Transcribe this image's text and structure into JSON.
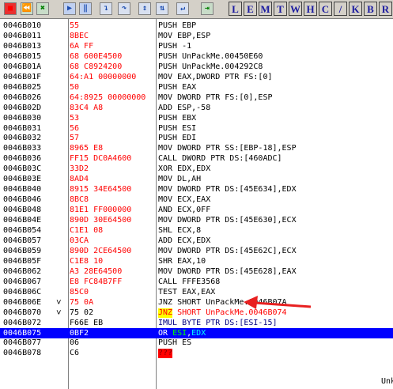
{
  "toolbar": {
    "icon_buttons": [
      {
        "glyph": "■",
        "name": "stop-icon",
        "style": "red"
      },
      {
        "glyph": "⏪",
        "name": "restart-icon",
        "style": "green"
      },
      {
        "glyph": "✖",
        "name": "close-icon",
        "style": "green"
      },
      {
        "glyph": "▶",
        "name": "run-icon",
        "style": "pale"
      },
      {
        "glyph": "‖",
        "name": "pause-icon",
        "style": "pale"
      },
      {
        "glyph": "↴",
        "name": "step-into-icon",
        "style": "pale2"
      },
      {
        "glyph": "↷",
        "name": "step-over-icon",
        "style": "pale2"
      },
      {
        "glyph": "↕",
        "name": "trace-into-icon",
        "style": "pale2"
      },
      {
        "glyph": "⇅",
        "name": "trace-over-icon",
        "style": "pale2"
      },
      {
        "glyph": "↵",
        "name": "execute-till-return-icon",
        "style": "pale2"
      },
      {
        "glyph": "⇥",
        "name": "go-to-icon",
        "style": "green"
      }
    ],
    "letter_buttons": [
      "L",
      "E",
      "M",
      "T",
      "W",
      "H",
      "C",
      "/",
      "K",
      "B",
      "R"
    ]
  },
  "rows": [
    {
      "addr": "0046B010",
      "mark": "",
      "hex": "55",
      "hex_red": true,
      "asm": "PUSH EBP"
    },
    {
      "addr": "0046B011",
      "mark": "",
      "hex": "8BEC",
      "hex_red": true,
      "asm": "MOV EBP,ESP"
    },
    {
      "addr": "0046B013",
      "mark": "",
      "hex": "6A FF",
      "hex_red": true,
      "asm": "PUSH -1"
    },
    {
      "addr": "0046B015",
      "mark": "",
      "hex": "68 600E4500",
      "hex_red": true,
      "asm": "PUSH UnPackMe.00450E60"
    },
    {
      "addr": "0046B01A",
      "mark": "",
      "hex": "68 C8924200",
      "hex_red": true,
      "asm": "PUSH UnPackMe.004292C8"
    },
    {
      "addr": "0046B01F",
      "mark": "",
      "hex": "64:A1 00000000",
      "hex_red": true,
      "asm": "MOV EAX,DWORD PTR FS:[0]"
    },
    {
      "addr": "0046B025",
      "mark": "",
      "hex": "50",
      "hex_red": true,
      "asm": "PUSH EAX"
    },
    {
      "addr": "0046B026",
      "mark": "",
      "hex": "64:8925 00000000",
      "hex_red": true,
      "asm": "MOV DWORD PTR FS:[0],ESP"
    },
    {
      "addr": "0046B02D",
      "mark": "",
      "hex": "83C4 A8",
      "hex_red": true,
      "asm": "ADD ESP,-58"
    },
    {
      "addr": "0046B030",
      "mark": "",
      "hex": "53",
      "hex_red": true,
      "asm": "PUSH EBX"
    },
    {
      "addr": "0046B031",
      "mark": "",
      "hex": "56",
      "hex_red": true,
      "asm": "PUSH ESI"
    },
    {
      "addr": "0046B032",
      "mark": "",
      "hex": "57",
      "hex_red": true,
      "asm": "PUSH EDI"
    },
    {
      "addr": "0046B033",
      "mark": "",
      "hex": "8965 E8",
      "hex_red": true,
      "asm": "MOV DWORD PTR SS:[EBP-18],ESP"
    },
    {
      "addr": "0046B036",
      "mark": "",
      "hex": "FF15 DC0A4600",
      "hex_red": true,
      "asm": "CALL DWORD PTR DS:[460ADC]"
    },
    {
      "addr": "0046B03C",
      "mark": "",
      "hex": "33D2",
      "hex_red": true,
      "asm": "XOR EDX,EDX"
    },
    {
      "addr": "0046B03E",
      "mark": "",
      "hex": "8AD4",
      "hex_red": true,
      "asm": "MOV DL,AH"
    },
    {
      "addr": "0046B040",
      "mark": "",
      "hex": "8915 34E64500",
      "hex_red": true,
      "asm": "MOV DWORD PTR DS:[45E634],EDX"
    },
    {
      "addr": "0046B046",
      "mark": "",
      "hex": "8BC8",
      "hex_red": true,
      "asm": "MOV ECX,EAX"
    },
    {
      "addr": "0046B048",
      "mark": "",
      "hex": "81E1 FF000000",
      "hex_red": true,
      "asm": "AND ECX,0FF"
    },
    {
      "addr": "0046B04E",
      "mark": "",
      "hex": "890D 30E64500",
      "hex_red": true,
      "asm": "MOV DWORD PTR DS:[45E630],ECX"
    },
    {
      "addr": "0046B054",
      "mark": "",
      "hex": "C1E1 08",
      "hex_red": true,
      "asm": "SHL ECX,8"
    },
    {
      "addr": "0046B057",
      "mark": "",
      "hex": "03CA",
      "hex_red": true,
      "asm": "ADD ECX,EDX"
    },
    {
      "addr": "0046B059",
      "mark": "",
      "hex": "890D 2CE64500",
      "hex_red": true,
      "asm": "MOV DWORD PTR DS:[45E62C],ECX"
    },
    {
      "addr": "0046B05F",
      "mark": "",
      "hex": "C1E8 10",
      "hex_red": true,
      "asm": "SHR EAX,10"
    },
    {
      "addr": "0046B062",
      "mark": "",
      "hex": "A3 28E64500",
      "hex_red": true,
      "asm": "MOV DWORD PTR DS:[45E628],EAX"
    },
    {
      "addr": "0046B067",
      "mark": "",
      "hex": "E8 FC84B7FF",
      "hex_red": true,
      "asm": "CALL FFFE3568"
    },
    {
      "addr": "0046B06C",
      "mark": "",
      "hex": "85C0",
      "hex_red": true,
      "asm": "TEST EAX,EAX"
    },
    {
      "addr": "0046B06E",
      "mark": "˅",
      "hex": "75 0A",
      "hex_red": true,
      "asm": "JNZ SHORT UnPackMe.0046B07A"
    },
    {
      "addr": "0046B070",
      "mark": "˅",
      "hex": "75 02",
      "hex_red": false,
      "asm": "JNZ SHORT UnPackMe.0046B074",
      "asm_style": "jnz-yellow"
    },
    {
      "addr": "0046B072",
      "mark": "",
      "hex": "F66E EB",
      "hex_red": false,
      "asm": "IMUL BYTE PTR DS:[ESI-15]",
      "asm_style": "blue"
    },
    {
      "addr": "0046B075",
      "mark": "",
      "hex": "0BF2",
      "hex_red": false,
      "asm": "OR ESI,EDX",
      "asm_style": "selected"
    },
    {
      "addr": "0046B077",
      "mark": "",
      "hex": "06",
      "hex_red": false,
      "asm": "PUSH ES"
    },
    {
      "addr": "0046B078",
      "mark": "",
      "hex": "C6",
      "hex_red": false,
      "asm": "???",
      "asm_style": "redbox"
    }
  ],
  "selected_row": "0046B075",
  "comment_fragment": "Unk",
  "colors": {
    "selection": "#0000ff",
    "accent_red": "#ff0000",
    "highlight_yellow": "#ffff00",
    "arrow": "#e82020"
  }
}
